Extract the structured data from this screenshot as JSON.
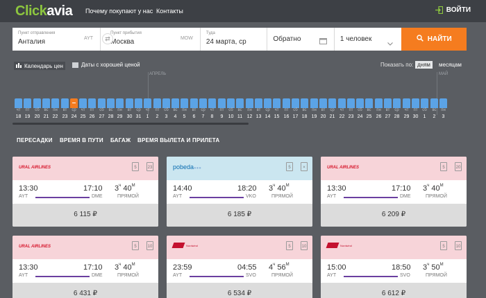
{
  "header": {
    "logo_part1": "Click",
    "logo_part2": "avia",
    "nav": [
      "Почему покупают у нас",
      "Контакты"
    ],
    "login_label": "ВОЙТИ"
  },
  "search": {
    "from_label": "Пункт отправления",
    "from_value": "Анталия",
    "from_code": "AYT",
    "to_label": "Пункт прибытия",
    "to_value": "Москва",
    "to_code": "MOW",
    "depart_label": "Туда",
    "depart_value": "24 марта, ср",
    "return_value": "Обратно",
    "passengers": "1 человек",
    "find_label": "НАЙТИ"
  },
  "filters": {
    "price_calendar": "Календарь цен",
    "good_price_dates": "Даты с хорошей ценой",
    "show_by": "Показать по:",
    "by_day": "дням",
    "by_month": "месяцам"
  },
  "calendar": {
    "month_april": "АПРЕЛЬ",
    "month_may": "МАЙ",
    "selected_index": 6,
    "days": [
      {
        "dow": "чт",
        "d": "18"
      },
      {
        "dow": "пт",
        "d": "19"
      },
      {
        "dow": "сб",
        "d": "20"
      },
      {
        "dow": "вс",
        "d": "21"
      },
      {
        "dow": "пн",
        "d": "22"
      },
      {
        "dow": "вт",
        "d": "23"
      },
      {
        "dow": "ср",
        "d": "24"
      },
      {
        "dow": "чт",
        "d": "25"
      },
      {
        "dow": "пт",
        "d": "26"
      },
      {
        "dow": "сб",
        "d": "27"
      },
      {
        "dow": "вс",
        "d": "28"
      },
      {
        "dow": "пн",
        "d": "29"
      },
      {
        "dow": "вт",
        "d": "30"
      },
      {
        "dow": "ср",
        "d": "31"
      },
      {
        "dow": "чт",
        "d": "1"
      },
      {
        "dow": "пт",
        "d": "2"
      },
      {
        "dow": "сб",
        "d": "3"
      },
      {
        "dow": "вс",
        "d": "4"
      },
      {
        "dow": "пн",
        "d": "5"
      },
      {
        "dow": "вт",
        "d": "6"
      },
      {
        "dow": "ср",
        "d": "7"
      },
      {
        "dow": "чт",
        "d": "8"
      },
      {
        "dow": "пт",
        "d": "9"
      },
      {
        "dow": "сб",
        "d": "10"
      },
      {
        "dow": "вс",
        "d": "11"
      },
      {
        "dow": "пн",
        "d": "12"
      },
      {
        "dow": "вт",
        "d": "13"
      },
      {
        "dow": "ср",
        "d": "14"
      },
      {
        "dow": "чт",
        "d": "15"
      },
      {
        "dow": "пт",
        "d": "16"
      },
      {
        "dow": "сб",
        "d": "17"
      },
      {
        "dow": "вс",
        "d": "18"
      },
      {
        "dow": "пн",
        "d": "19"
      },
      {
        "dow": "вт",
        "d": "20"
      },
      {
        "dow": "ср",
        "d": "21"
      },
      {
        "dow": "чт",
        "d": "22"
      },
      {
        "dow": "пт",
        "d": "23"
      },
      {
        "dow": "сб",
        "d": "24"
      },
      {
        "dow": "вс",
        "d": "25"
      },
      {
        "dow": "пн",
        "d": "26"
      },
      {
        "dow": "вт",
        "d": "27"
      },
      {
        "dow": "ср",
        "d": "28"
      },
      {
        "dow": "чт",
        "d": "29"
      },
      {
        "dow": "пт",
        "d": "30"
      },
      {
        "dow": "сб",
        "d": "1"
      },
      {
        "dow": "вс",
        "d": "2"
      },
      {
        "dow": "пн",
        "d": "3"
      }
    ]
  },
  "sort_tabs": [
    "ПЕРЕСАДКИ",
    "ВРЕМЯ В ПУТИ",
    "БАГАЖ",
    "ВРЕМЯ ВЫЛЕТА И ПРИЛЕТА"
  ],
  "flights": [
    {
      "airline": "URAL AIRLINES",
      "style": "ural",
      "bg": "pink",
      "bag1": "5",
      "bag2": "23",
      "dep": "13:30",
      "arr": "17:10",
      "dep_code": "AYT",
      "arr_code": "DME",
      "dur_h": "3",
      "dur_m": "40",
      "h_unit": "ч",
      "m_unit": "М",
      "stops": "ПРЯМОЙ",
      "price": "6 115 ₽"
    },
    {
      "airline": "pobeda",
      "style": "pobeda",
      "bg": "blue",
      "bag1": "5",
      "bag2": "×",
      "dep": "14:40",
      "arr": "18:20",
      "dep_code": "AYT",
      "arr_code": "VKO",
      "dur_h": "3",
      "dur_m": "40",
      "h_unit": "ч",
      "m_unit": "М",
      "stops": "ПРЯМОЙ",
      "price": "6 185 ₽"
    },
    {
      "airline": "URAL AIRLINES",
      "style": "ural",
      "bg": "pink",
      "bag1": "5",
      "bag2": "20",
      "dep": "13:30",
      "arr": "17:10",
      "dep_code": "AYT",
      "arr_code": "DME",
      "dur_h": "3",
      "dur_m": "40",
      "h_unit": "ч",
      "m_unit": "М",
      "stops": "ПРЯМОЙ",
      "price": "6 209 ₽"
    },
    {
      "airline": "URAL AIRLINES",
      "style": "ural",
      "bg": "pink",
      "bag1": "5",
      "bag2": "10",
      "dep": "13:30",
      "arr": "17:10",
      "dep_code": "AYT",
      "arr_code": "DME",
      "dur_h": "3",
      "dur_m": "40",
      "h_unit": "ч",
      "m_unit": "М",
      "stops": "ПРЯМОЙ",
      "price": "6 431 ₽"
    },
    {
      "airline": "Nordwind",
      "style": "nordwind",
      "bg": "pink",
      "bag1": "5",
      "bag2": "10",
      "dep": "23:59",
      "arr": "04:55",
      "dep_code": "AYT",
      "arr_code": "SVO",
      "dur_h": "4",
      "dur_m": "56",
      "h_unit": "ч",
      "m_unit": "М",
      "stops": "ПРЯМОЙ",
      "price": "6 534 ₽"
    },
    {
      "airline": "Nordwind",
      "style": "nordwind",
      "bg": "pink",
      "bag1": "5",
      "bag2": "10",
      "dep": "15:00",
      "arr": "18:50",
      "dep_code": "AYT",
      "arr_code": "SVO",
      "dur_h": "3",
      "dur_m": "50",
      "h_unit": "ч",
      "m_unit": "М",
      "stops": "ПРЯМОЙ",
      "price": "6 612 ₽"
    }
  ],
  "colors": {
    "accent": "#f57c1f",
    "logo_green": "#8dc63f",
    "bar_blue": "#5ba3e6",
    "route_purple": "#6a3fa0"
  }
}
